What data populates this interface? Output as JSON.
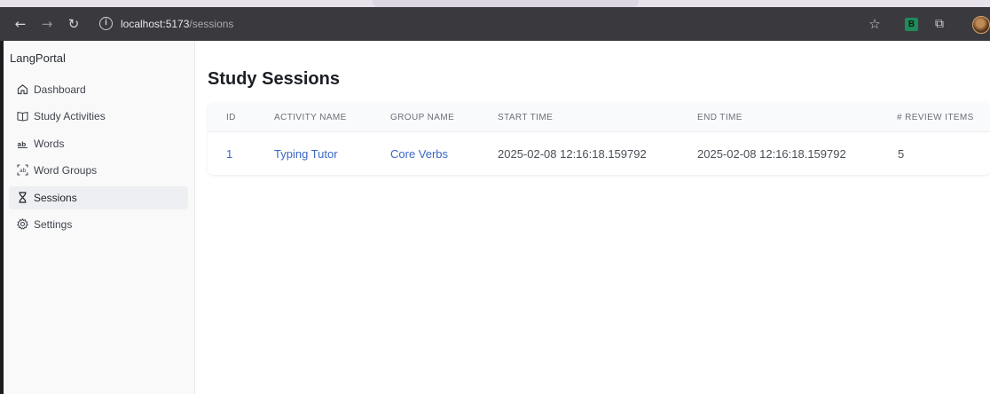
{
  "browser": {
    "url_host": "localhost:5173",
    "url_path": "/sessions"
  },
  "sidebar": {
    "brand": "LangPortal",
    "items": [
      {
        "label": "Dashboard",
        "icon": "home-icon",
        "active": false
      },
      {
        "label": "Study Activities",
        "icon": "book-icon",
        "active": false
      },
      {
        "label": "Words",
        "icon": "words-icon",
        "active": false
      },
      {
        "label": "Word Groups",
        "icon": "word-groups-icon",
        "active": false
      },
      {
        "label": "Sessions",
        "icon": "hourglass-icon",
        "active": true
      },
      {
        "label": "Settings",
        "icon": "gear-icon",
        "active": false
      }
    ]
  },
  "page": {
    "title": "Study Sessions"
  },
  "table": {
    "columns": [
      "ID",
      "ACTIVITY NAME",
      "GROUP NAME",
      "START TIME",
      "END TIME",
      "# REVIEW ITEMS"
    ],
    "rows": [
      [
        "1",
        "Typing Tutor",
        "Core Verbs",
        "2025-02-08 12:16:18.159792",
        "2025-02-08 12:16:18.159792",
        "5"
      ]
    ]
  },
  "colors": {
    "link": "#3b66c4",
    "active_nav_bg": "#eeeff2"
  }
}
